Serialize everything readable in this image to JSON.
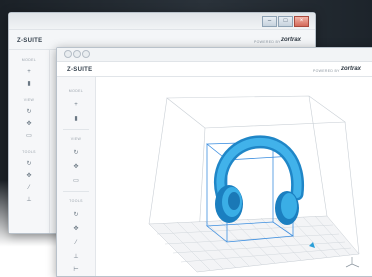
{
  "app": {
    "brand": "Z-SUITE",
    "powered_by": "POWERED BY",
    "vendor": "zortrax"
  },
  "window_controls": {
    "minimize": "–",
    "maximize": "□",
    "close": "×"
  },
  "sidebar": {
    "sections": [
      {
        "label": "MODEL",
        "tools": [
          "plus-icon",
          "trash-icon"
        ]
      },
      {
        "label": "VIEW",
        "tools": [
          "rotate-icon",
          "move-icon",
          "camera-icon"
        ]
      },
      {
        "label": "TOOLS",
        "tools": [
          "rotate-model-icon",
          "move-model-icon",
          "scale-icon",
          "place-on-bed-icon",
          "cut-icon"
        ]
      }
    ]
  },
  "viewport": {
    "model": "headphones",
    "model_color": "#2a9fd8",
    "bounding_box_color": "#3d8fe0"
  }
}
